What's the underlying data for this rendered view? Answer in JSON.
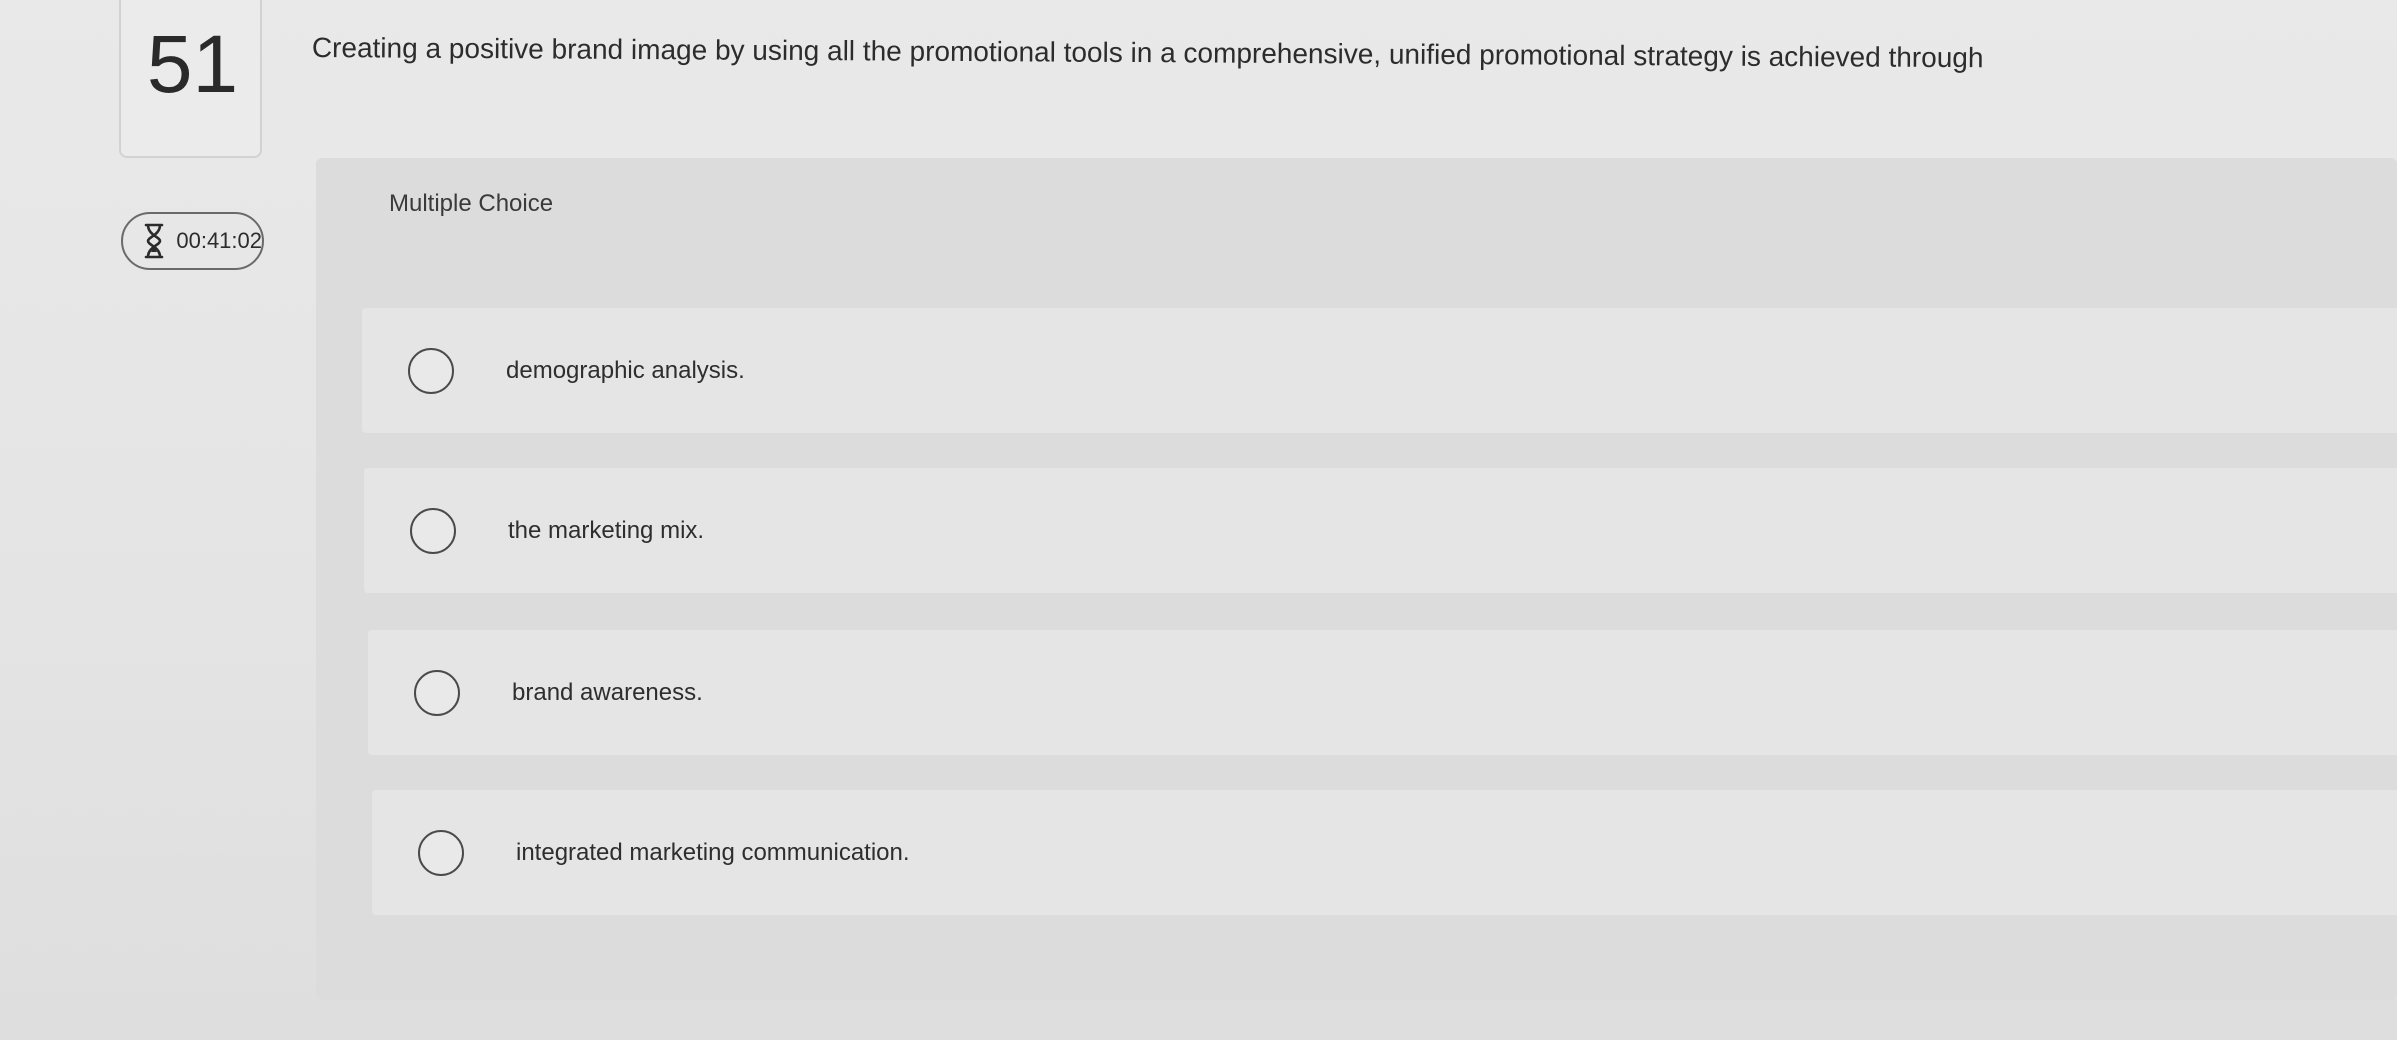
{
  "question": {
    "number": "51",
    "text": "Creating a positive brand image by using all the promotional tools in a comprehensive, unified promotional strategy is achieved through",
    "type_label": "Multiple Choice"
  },
  "timer": {
    "icon": "hourglass-icon",
    "value": "00:41:02"
  },
  "options": [
    {
      "label": "demographic analysis."
    },
    {
      "label": "the marketing mix."
    },
    {
      "label": "brand awareness."
    },
    {
      "label": "integrated marketing communication."
    }
  ]
}
